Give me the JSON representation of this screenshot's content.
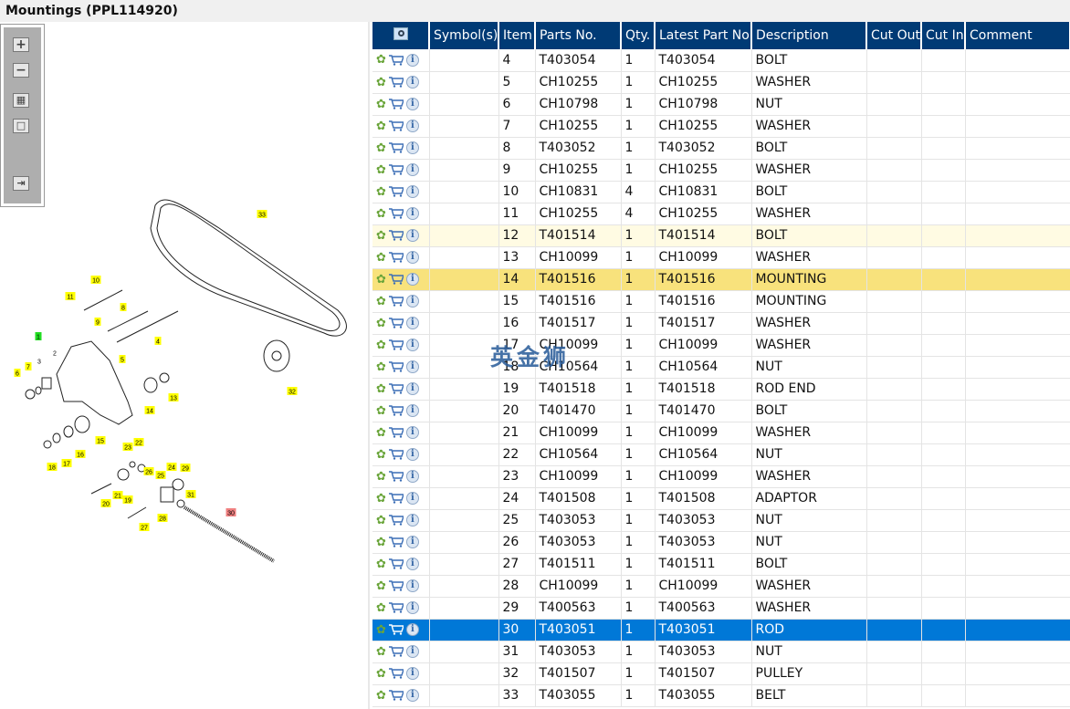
{
  "title": "Mountings (PPL114920)",
  "watermark": "英金狮",
  "toolbar": {
    "zoom_in": "+",
    "zoom_out": "−",
    "fit": "▦",
    "actual": "□",
    "toggle": "⇥"
  },
  "columns": [
    "Symbol(s)",
    "Item",
    "Parts No.",
    "Qty.",
    "Latest Part No.",
    "Description",
    "Cut Out",
    "Cut In",
    "Comment"
  ],
  "colors": {
    "header": "#003a75",
    "selected": "#0078d7",
    "highlight": "#f8e27c",
    "light": "#fffbe3"
  },
  "rows": [
    {
      "item": "4",
      "part": "T403054",
      "qty": "1",
      "latest": "T403054",
      "desc": "BOLT"
    },
    {
      "item": "5",
      "part": "CH10255",
      "qty": "1",
      "latest": "CH10255",
      "desc": "WASHER"
    },
    {
      "item": "6",
      "part": "CH10798",
      "qty": "1",
      "latest": "CH10798",
      "desc": "NUT"
    },
    {
      "item": "7",
      "part": "CH10255",
      "qty": "1",
      "latest": "CH10255",
      "desc": "WASHER"
    },
    {
      "item": "8",
      "part": "T403052",
      "qty": "1",
      "latest": "T403052",
      "desc": "BOLT"
    },
    {
      "item": "9",
      "part": "CH10255",
      "qty": "1",
      "latest": "CH10255",
      "desc": "WASHER"
    },
    {
      "item": "10",
      "part": "CH10831",
      "qty": "4",
      "latest": "CH10831",
      "desc": "BOLT"
    },
    {
      "item": "11",
      "part": "CH10255",
      "qty": "4",
      "latest": "CH10255",
      "desc": "WASHER"
    },
    {
      "item": "12",
      "part": "T401514",
      "qty": "1",
      "latest": "T401514",
      "desc": "BOLT",
      "state": "lightyellow"
    },
    {
      "item": "13",
      "part": "CH10099",
      "qty": "1",
      "latest": "CH10099",
      "desc": "WASHER"
    },
    {
      "item": "14",
      "part": "T401516",
      "qty": "1",
      "latest": "T401516",
      "desc": "MOUNTING",
      "state": "yellow"
    },
    {
      "item": "15",
      "part": "T401516",
      "qty": "1",
      "latest": "T401516",
      "desc": "MOUNTING"
    },
    {
      "item": "16",
      "part": "T401517",
      "qty": "1",
      "latest": "T401517",
      "desc": "WASHER"
    },
    {
      "item": "17",
      "part": "CH10099",
      "qty": "1",
      "latest": "CH10099",
      "desc": "WASHER"
    },
    {
      "item": "18",
      "part": "CH10564",
      "qty": "1",
      "latest": "CH10564",
      "desc": "NUT"
    },
    {
      "item": "19",
      "part": "T401518",
      "qty": "1",
      "latest": "T401518",
      "desc": "ROD END"
    },
    {
      "item": "20",
      "part": "T401470",
      "qty": "1",
      "latest": "T401470",
      "desc": "BOLT"
    },
    {
      "item": "21",
      "part": "CH10099",
      "qty": "1",
      "latest": "CH10099",
      "desc": "WASHER"
    },
    {
      "item": "22",
      "part": "CH10564",
      "qty": "1",
      "latest": "CH10564",
      "desc": "NUT"
    },
    {
      "item": "23",
      "part": "CH10099",
      "qty": "1",
      "latest": "CH10099",
      "desc": "WASHER"
    },
    {
      "item": "24",
      "part": "T401508",
      "qty": "1",
      "latest": "T401508",
      "desc": "ADAPTOR"
    },
    {
      "item": "25",
      "part": "T403053",
      "qty": "1",
      "latest": "T403053",
      "desc": "NUT"
    },
    {
      "item": "26",
      "part": "T403053",
      "qty": "1",
      "latest": "T403053",
      "desc": "NUT"
    },
    {
      "item": "27",
      "part": "T401511",
      "qty": "1",
      "latest": "T401511",
      "desc": "BOLT"
    },
    {
      "item": "28",
      "part": "CH10099",
      "qty": "1",
      "latest": "CH10099",
      "desc": "WASHER"
    },
    {
      "item": "29",
      "part": "T400563",
      "qty": "1",
      "latest": "T400563",
      "desc": "WASHER"
    },
    {
      "item": "30",
      "part": "T403051",
      "qty": "1",
      "latest": "T403051",
      "desc": "ROD",
      "state": "selected"
    },
    {
      "item": "31",
      "part": "T403053",
      "qty": "1",
      "latest": "T403053",
      "desc": "NUT"
    },
    {
      "item": "32",
      "part": "T401507",
      "qty": "1",
      "latest": "T401507",
      "desc": "PULLEY"
    },
    {
      "item": "33",
      "part": "T403055",
      "qty": "1",
      "latest": "T403055",
      "desc": "BELT"
    }
  ],
  "callouts": [
    {
      "n": "33"
    },
    {
      "n": "10"
    },
    {
      "n": "11"
    },
    {
      "n": "8"
    },
    {
      "n": "9"
    },
    {
      "n": "1",
      "kind": "green"
    },
    {
      "n": "4"
    },
    {
      "n": "5"
    },
    {
      "n": "7"
    },
    {
      "n": "6"
    },
    {
      "n": "13"
    },
    {
      "n": "14"
    },
    {
      "n": "32"
    },
    {
      "n": "15"
    },
    {
      "n": "16"
    },
    {
      "n": "17"
    },
    {
      "n": "18"
    },
    {
      "n": "23"
    },
    {
      "n": "22"
    },
    {
      "n": "26"
    },
    {
      "n": "25"
    },
    {
      "n": "24"
    },
    {
      "n": "29"
    },
    {
      "n": "31"
    },
    {
      "n": "21"
    },
    {
      "n": "19"
    },
    {
      "n": "20"
    },
    {
      "n": "28"
    },
    {
      "n": "27"
    },
    {
      "n": "30",
      "kind": "red"
    },
    {
      "n": "2",
      "kind": "plain"
    },
    {
      "n": "3",
      "kind": "plain"
    }
  ]
}
